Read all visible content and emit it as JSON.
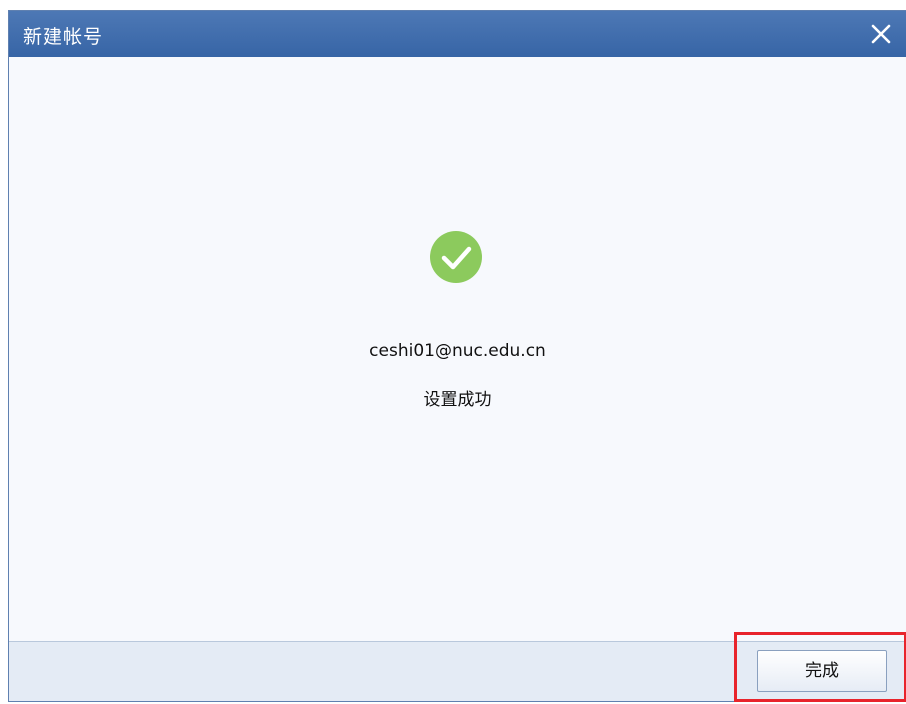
{
  "dialog": {
    "title": "新建帐号",
    "close_icon": "close-icon"
  },
  "result": {
    "status_icon": "check-circle-icon",
    "status_color": "#8cca5d",
    "email": "ceshi01@nuc.edu.cn",
    "message": "设置成功"
  },
  "footer": {
    "finish_label": "完成",
    "highlight_color": "#e8242c"
  }
}
